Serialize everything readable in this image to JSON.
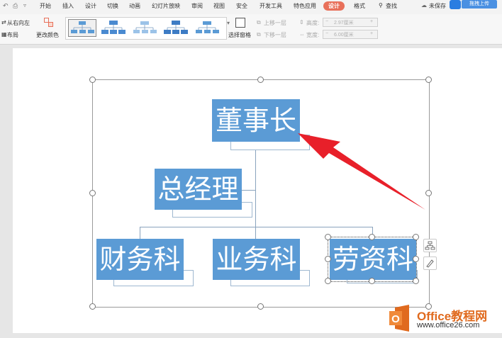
{
  "tabs": [
    {
      "label": "开始"
    },
    {
      "label": "插入"
    },
    {
      "label": "设计"
    },
    {
      "label": "切换"
    },
    {
      "label": "动画"
    },
    {
      "label": "幻灯片放映"
    },
    {
      "label": "审阅"
    },
    {
      "label": "视图"
    },
    {
      "label": "安全"
    },
    {
      "label": "开发工具"
    },
    {
      "label": "特色应用"
    },
    {
      "label": "设计",
      "active": true
    },
    {
      "label": "格式"
    }
  ],
  "search_label": "查找",
  "unsaved_label": "未保存",
  "upload_label": "拖拽上传",
  "ribbon": {
    "rtl_label": "从右向左",
    "layout_label": "布局",
    "recolor_label": "更改颜色",
    "selection_pane_label": "选择窗格",
    "move_up_label": "上移一层",
    "move_down_label": "下移一层",
    "height_label": "高度:",
    "height_value": "2.97厘米",
    "width_label": "宽度:",
    "width_value": "6.00厘米"
  },
  "org_chart": {
    "top": "董事长",
    "second": "总经理",
    "bottom": [
      "财务科",
      "业务科",
      "劳资科"
    ]
  },
  "colors": {
    "accent": "#e8705a",
    "box": "#5b9bd5",
    "arrow": "#e8202a"
  },
  "watermark": {
    "brand": "Office教程网",
    "url": "www.office26.com"
  }
}
